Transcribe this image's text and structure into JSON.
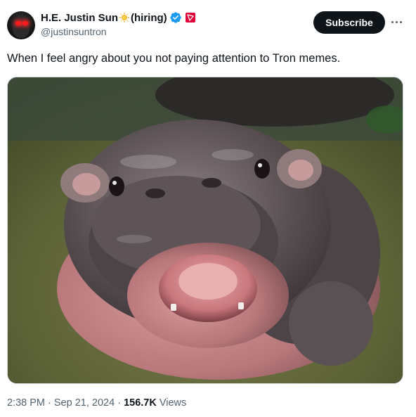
{
  "author": {
    "display_name": "H.E. Justin Sun",
    "name_suffix": "(hiring)",
    "handle": "@justinsuntron",
    "verified_color": "#1d9bf0",
    "affiliate_badge_color": "#e0003a",
    "name_emoji_icon": "sun-icon"
  },
  "actions": {
    "subscribe_label": "Subscribe",
    "more_icon": "more-icon"
  },
  "tweet": {
    "text": "When I feel angry about you not paying attention to Tron memes."
  },
  "media": {
    "icon": "photo-pygmy-hippo"
  },
  "meta": {
    "time": "2:38 PM",
    "sep1": " · ",
    "date": "Sep 21, 2024",
    "sep2": " · ",
    "views_count": "156.7K",
    "views_label": " Views"
  }
}
